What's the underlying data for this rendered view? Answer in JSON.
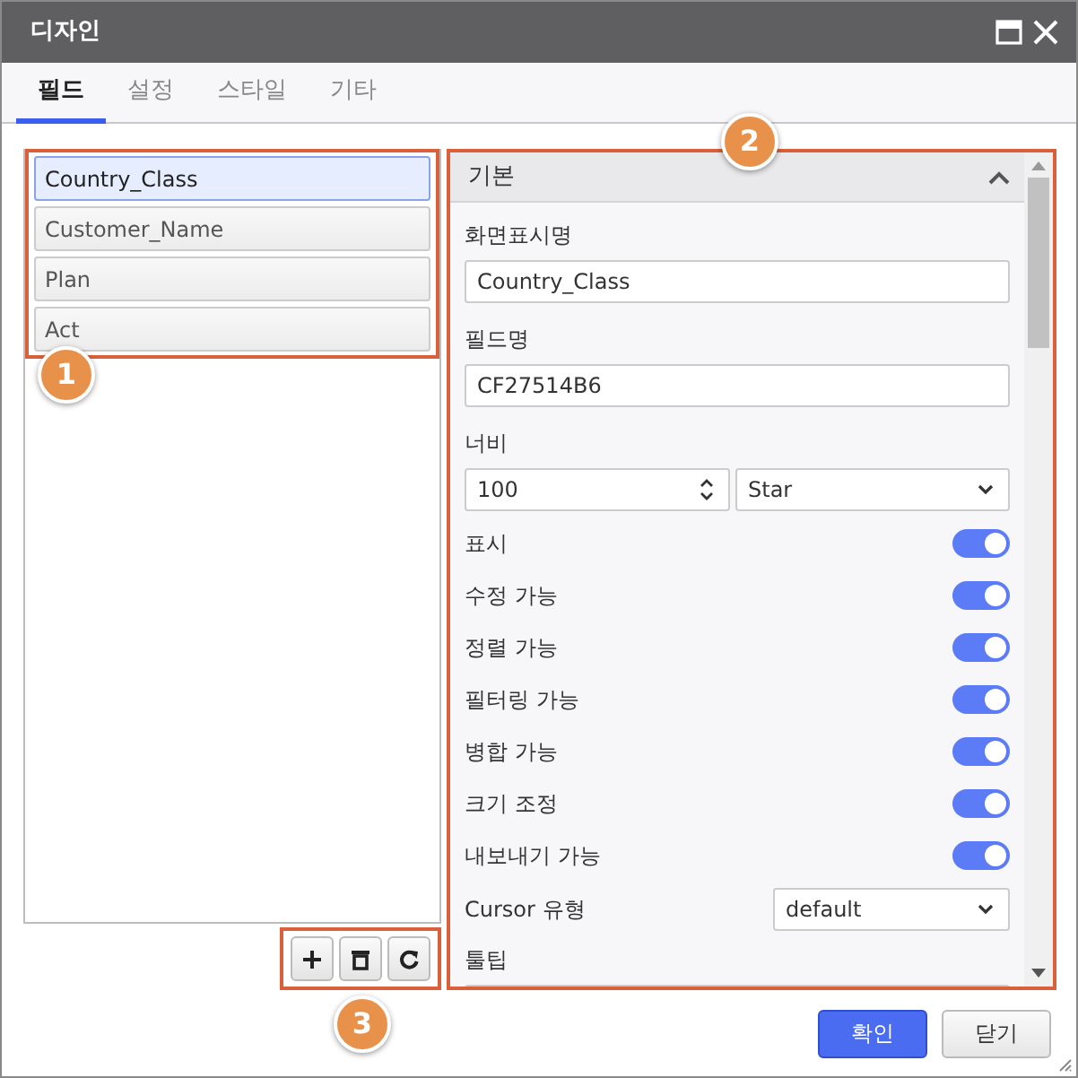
{
  "window": {
    "title": "디자인"
  },
  "tabs": [
    {
      "label": "필드",
      "selected": true
    },
    {
      "label": "설정",
      "selected": false
    },
    {
      "label": "스타일",
      "selected": false
    },
    {
      "label": "기타",
      "selected": false
    }
  ],
  "field_list": [
    {
      "label": "Country_Class",
      "selected": true
    },
    {
      "label": "Customer_Name",
      "selected": false
    },
    {
      "label": "Plan",
      "selected": false
    },
    {
      "label": "Act",
      "selected": false
    }
  ],
  "list_buttons": [
    {
      "kind": "add"
    },
    {
      "kind": "delete"
    },
    {
      "kind": "refresh"
    }
  ],
  "section": {
    "title": "기본",
    "expanded": true
  },
  "properties": [
    {
      "kind": "text",
      "label": "화면표시명",
      "value": "Country_Class"
    },
    {
      "kind": "text",
      "label": "필드명",
      "value": "CF27514B6"
    },
    {
      "kind": "width",
      "label": "너비",
      "value": "100",
      "unit": "Star"
    },
    {
      "kind": "toggle",
      "label": "표시",
      "on": true
    },
    {
      "kind": "toggle",
      "label": "수정 가능",
      "on": true
    },
    {
      "kind": "toggle",
      "label": "정렬 가능",
      "on": true
    },
    {
      "kind": "toggle",
      "label": "필터링 가능",
      "on": true
    },
    {
      "kind": "toggle",
      "label": "병합 가능",
      "on": true
    },
    {
      "kind": "toggle",
      "label": "크기 조정",
      "on": true
    },
    {
      "kind": "toggle",
      "label": "내보내기 가능",
      "on": true
    },
    {
      "kind": "select",
      "label": "Cursor 유형",
      "value": "default"
    },
    {
      "kind": "text",
      "label": "툴팁"
    }
  ],
  "footer_buttons": [
    {
      "label": "확인",
      "kind": "primary"
    },
    {
      "label": "닫기",
      "kind": "secondary"
    }
  ],
  "callouts": [
    "1",
    "2",
    "3"
  ]
}
